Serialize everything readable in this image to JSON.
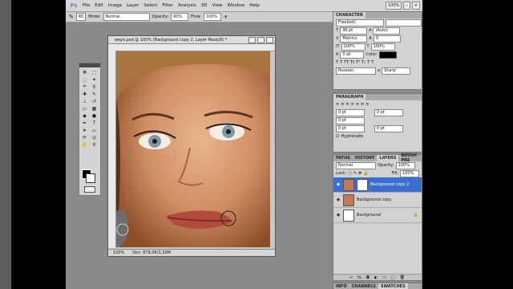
{
  "app": {
    "logo": "Ps"
  },
  "menu": [
    "File",
    "Edit",
    "Image",
    "Layer",
    "Select",
    "Filter",
    "Analysis",
    "3D",
    "View",
    "Window",
    "Help"
  ],
  "menu_right": {
    "zoom": "100%"
  },
  "options": {
    "brush_size": "60",
    "mode_label": "Mode:",
    "mode_value": "Normal",
    "opacity_label": "Opacity:",
    "opacity_value": "60%",
    "flow_label": "Flow:",
    "flow_value": "100%"
  },
  "document": {
    "title": "weyo.psd @ 100% (Background copy 2, Layer Mask/8) *",
    "zoom": "100%",
    "doc_info": "Doc: 679,0K/1,39M"
  },
  "character": {
    "tab": "CHARACTER",
    "font": "FreeSetC",
    "size": "36 pt",
    "leading": "(Auto)",
    "kerning": "Metrics",
    "tracking": "0",
    "vscale": "100%",
    "hscale": "100%",
    "baseline": "0 pt",
    "color_label": "Color:",
    "language": "Russian",
    "aa": "Sharp"
  },
  "paragraph": {
    "tab": "PARAGRAPH",
    "indent_left": "0 pt",
    "indent_first": "0 pt",
    "indent_right": "0 pt",
    "space_before": "0 pt",
    "space_after": "0 pt",
    "hyphenate": "Hyphenate"
  },
  "layers": {
    "tabs": [
      "PATHS",
      "HISTORY",
      "LAYERS",
      "BRUSH PRE"
    ],
    "blend": "Normal",
    "opacity_label": "Opacity:",
    "opacity": "100%",
    "lock_label": "Lock:",
    "fill_label": "Fill:",
    "fill": "100%",
    "items": [
      {
        "name": "Background copy 2"
      },
      {
        "name": "Background copy"
      },
      {
        "name": "Background"
      }
    ]
  },
  "bottom_tabs": [
    "INFO",
    "CHANNELS",
    "SWATCHES"
  ]
}
